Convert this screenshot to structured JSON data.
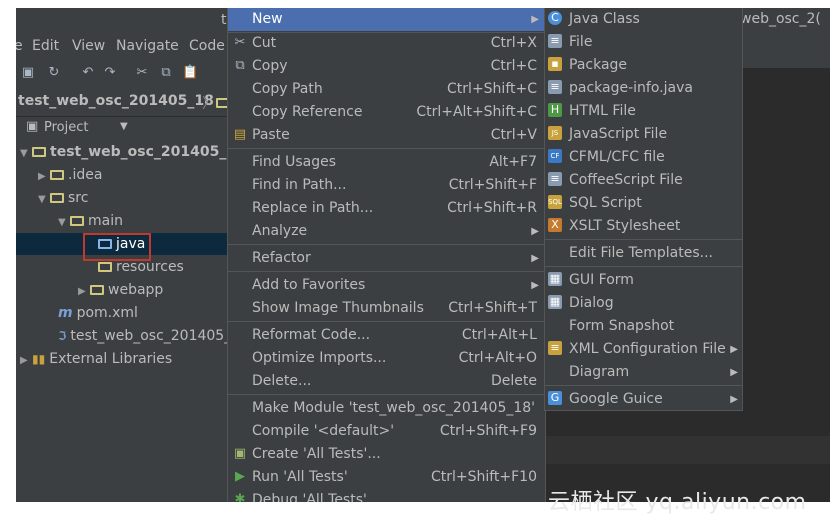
{
  "window": {
    "title_left": "t",
    "title_right": "web_osc_2("
  },
  "menubar": {
    "items": [
      {
        "prefix": "e",
        "label": ""
      },
      {
        "label": "Edit",
        "u": "E"
      },
      {
        "label": "View",
        "u": "V"
      },
      {
        "label": "Navigate",
        "u": "N"
      },
      {
        "label": "Code",
        "u": "C"
      }
    ]
  },
  "breadcrumb": {
    "project": "test_web_osc_201405_18"
  },
  "project_panel": {
    "header": "Project"
  },
  "tree": [
    {
      "label": "test_web_osc_201405_18",
      "bold": true
    },
    {
      "label": ".idea"
    },
    {
      "label": "src"
    },
    {
      "label": "main"
    },
    {
      "label": "java"
    },
    {
      "label": "resources"
    },
    {
      "label": "webapp"
    },
    {
      "label": "pom.xml"
    },
    {
      "label": "test_web_osc_201405_1"
    },
    {
      "label": "External Libraries"
    }
  ],
  "context_menu": [
    {
      "label": "New",
      "shortcut": "",
      "submenu": true,
      "highlight": true,
      "icon": ""
    },
    {
      "label": "Cut",
      "shortcut": "Ctrl+X",
      "icon": "scissors-icon"
    },
    {
      "label": "Copy",
      "shortcut": "Ctrl+C",
      "icon": "copy-icon"
    },
    {
      "label": "Copy Path",
      "shortcut": "Ctrl+Shift+C",
      "icon": ""
    },
    {
      "label": "Copy Reference",
      "shortcut": "Ctrl+Alt+Shift+C",
      "icon": ""
    },
    {
      "label": "Paste",
      "shortcut": "Ctrl+V",
      "icon": "paste-icon"
    },
    {
      "label": "Find Usages",
      "shortcut": "Alt+F7",
      "icon": ""
    },
    {
      "label": "Find in Path...",
      "shortcut": "Ctrl+Shift+F",
      "icon": ""
    },
    {
      "label": "Replace in Path...",
      "shortcut": "Ctrl+Shift+R",
      "icon": ""
    },
    {
      "label": "Analyze",
      "shortcut": "",
      "submenu": true,
      "icon": ""
    },
    {
      "label": "Refactor",
      "shortcut": "",
      "submenu": true,
      "icon": ""
    },
    {
      "label": "Add to Favorites",
      "shortcut": "",
      "submenu": true,
      "icon": ""
    },
    {
      "label": "Show Image Thumbnails",
      "shortcut": "Ctrl+Shift+T",
      "icon": ""
    },
    {
      "label": "Reformat Code...",
      "shortcut": "Ctrl+Alt+L",
      "icon": ""
    },
    {
      "label": "Optimize Imports...",
      "shortcut": "Ctrl+Alt+O",
      "icon": ""
    },
    {
      "label": "Delete...",
      "shortcut": "Delete",
      "icon": ""
    },
    {
      "label": "Make Module 'test_web_osc_201405_18'",
      "shortcut": "",
      "icon": ""
    },
    {
      "label": "Compile '<default>'",
      "shortcut": "Ctrl+Shift+F9",
      "icon": ""
    },
    {
      "label": "Create 'All Tests'...",
      "shortcut": "",
      "icon": "test-icon"
    },
    {
      "label": "Run 'All Tests'",
      "shortcut": "Ctrl+Shift+F10",
      "icon": "run-icon"
    },
    {
      "label": "Debug 'All Tests'",
      "shortcut": "",
      "icon": "debug-icon"
    }
  ],
  "new_submenu": [
    {
      "label": "Java Class",
      "icon": "C",
      "icon_color": "#4a8fd8",
      "round": true
    },
    {
      "label": "File",
      "icon": "≡",
      "icon_color": "#8a9bb0"
    },
    {
      "label": "Package",
      "icon": "▪",
      "icon_color": "#c9a23e"
    },
    {
      "label": "package-info.java",
      "icon": "≡",
      "icon_color": "#8a9bb0"
    },
    {
      "label": "HTML File",
      "icon": "H",
      "icon_color": "#4e9a44"
    },
    {
      "label": "JavaScript File",
      "icon": "JS",
      "icon_color": "#c9a23e"
    },
    {
      "label": "CFML/CFC file",
      "icon": "CF",
      "icon_color": "#3a7ac4"
    },
    {
      "label": "CoffeeScript File",
      "icon": "≡",
      "icon_color": "#8a9bb0"
    },
    {
      "label": "SQL Script",
      "icon": "SQL",
      "icon_color": "#c9a23e"
    },
    {
      "label": "XSLT Stylesheet",
      "icon": "X",
      "icon_color": "#c67a2e"
    },
    {
      "label": "Edit File Templates...",
      "icon": ""
    },
    {
      "label": "GUI Form",
      "icon": "▦",
      "icon_color": "#8a9bb0"
    },
    {
      "label": "Dialog",
      "icon": "▦",
      "icon_color": "#8a9bb0"
    },
    {
      "label": "Form Snapshot",
      "icon": ""
    },
    {
      "label": "XML Configuration File",
      "icon": "≡",
      "icon_color": "#c9a23e",
      "submenu": true
    },
    {
      "label": "Diagram",
      "icon": "",
      "submenu": true
    },
    {
      "label": "Google Guice",
      "icon": "G",
      "icon_color": "#4a8fd8",
      "submenu": true
    }
  ],
  "watermark": "云栖社区 yq.aliyun.com"
}
